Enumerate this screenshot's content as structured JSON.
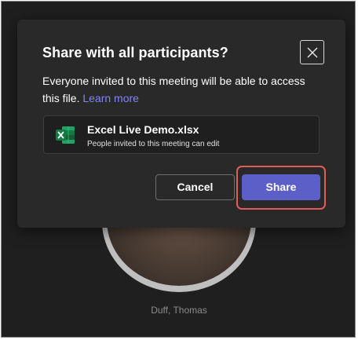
{
  "dialog": {
    "title": "Share with all participants?",
    "body_text": "Everyone invited to this meeting will be able to access this file.",
    "learn_more_label": "Learn more",
    "close_icon": "close-icon",
    "file": {
      "icon": "excel-file-icon",
      "name": "Excel Live Demo.xlsx",
      "permission_note": "People invited to this meeting can edit"
    },
    "cancel_label": "Cancel",
    "share_label": "Share"
  },
  "background": {
    "participant_name": "Duff, Thomas"
  },
  "colors": {
    "accent": "#5b5fc7",
    "link": "#7f85f5",
    "highlight": "#e25c5c",
    "excel_green": "#107c41"
  }
}
